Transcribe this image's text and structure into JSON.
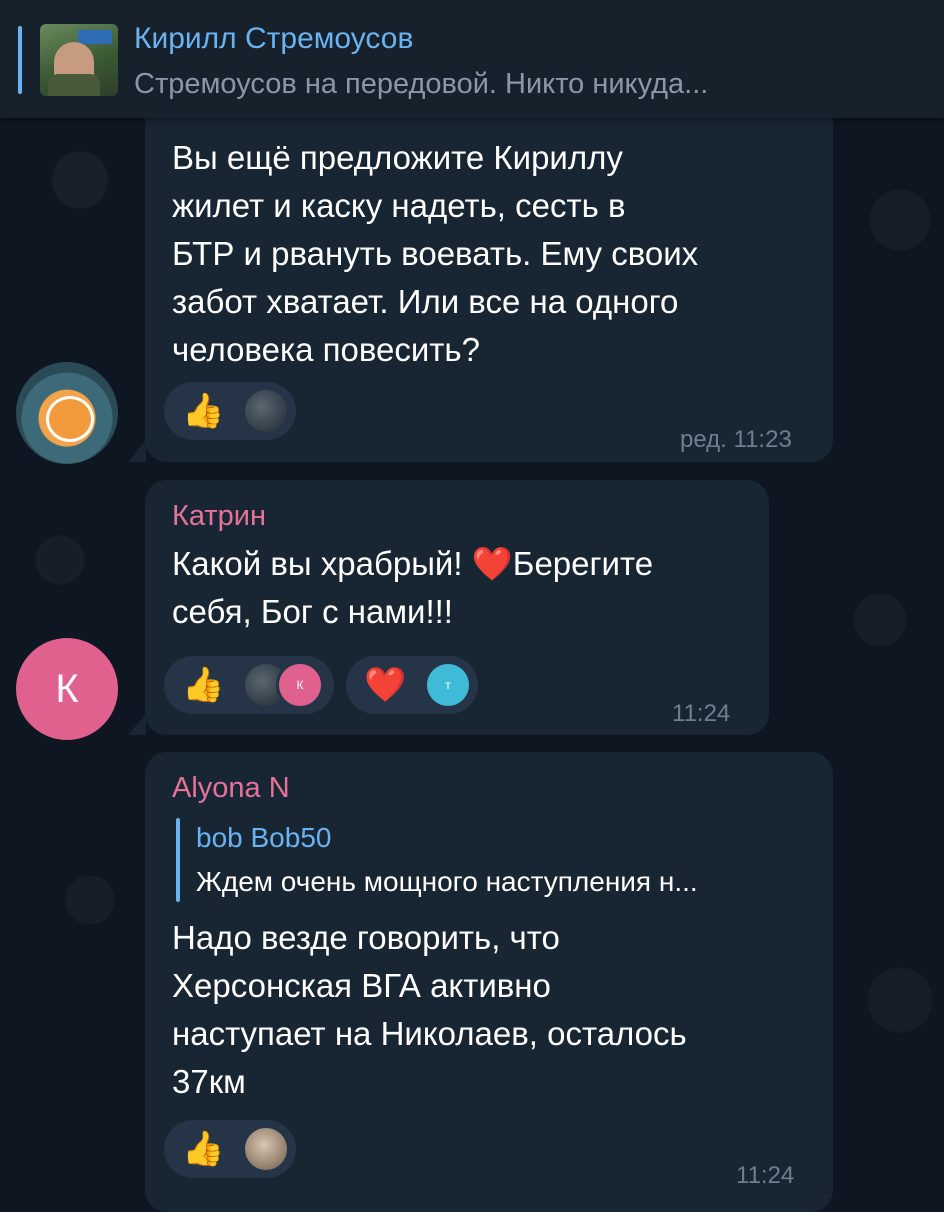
{
  "pinned": {
    "title": "Кирилл Стремоусов",
    "subtitle": "Стремоусов на передовой. Никто никуда..."
  },
  "messages": [
    {
      "text": "Вы ещё предложите Кириллу\nжилет и каску надеть, сесть в\nБТР и рвануть воевать. Ему своих\nзабот хватает. Или все на одного\nчеловека повесить?",
      "time": "ред. 11:23",
      "reactions": [
        {
          "emoji": "👍",
          "avatars": [
            "photo-avatar"
          ]
        }
      ]
    },
    {
      "sender": "Катрин",
      "sender_color": "#e57399",
      "avatar_letter": "К",
      "text": "Какой вы храбрый! ❤️Берегите\nсебя, Бог с нами!!!",
      "time": "11:24",
      "reactions": [
        {
          "emoji": "👍",
          "avatars": [
            "photo-avatar",
            "К"
          ]
        },
        {
          "emoji": "❤️",
          "avatars": [
            "т"
          ]
        }
      ]
    },
    {
      "sender": "Alyona N",
      "sender_color": "#e57399",
      "quote": {
        "author": "bob Bob50",
        "text": "Ждем очень мощного наступления н..."
      },
      "text": "Надо везде говорить, что\nХерсонская ВГА активно\nнаступает на Николаев, осталось\n37км",
      "time": "11:24",
      "reactions": [
        {
          "emoji": "👍",
          "avatars": [
            "photo-avatar"
          ]
        }
      ]
    }
  ]
}
